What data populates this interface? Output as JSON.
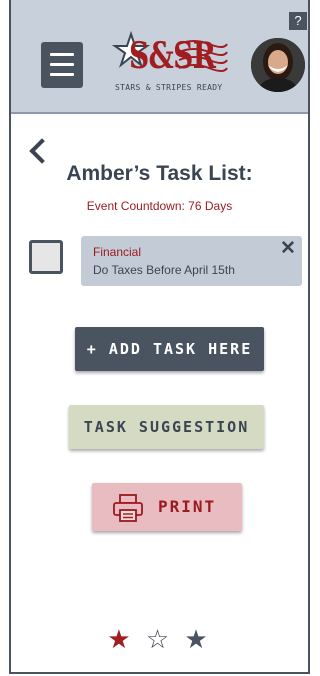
{
  "header": {
    "help_label": "?",
    "logo_text": "S&SR",
    "logo_tagline": "STARS & STRIPES READY"
  },
  "page": {
    "title": "Amber’s Task List:",
    "countdown": "Event Countdown: 76 Days"
  },
  "tasks": [
    {
      "category": "Financial",
      "name": "Do Taxes Before April 15th",
      "close": "✕"
    }
  ],
  "buttons": {
    "add_task": "+ ADD TASK HERE",
    "task_suggestion": "TASK SUGGESTION",
    "print": "PRINT"
  },
  "footer": {
    "star_1": "★",
    "star_2": "☆",
    "star_3": "★"
  },
  "colors": {
    "header_bg": "#c8d0dc",
    "brand_red": "#a01d21",
    "slate": "#4a5360"
  }
}
